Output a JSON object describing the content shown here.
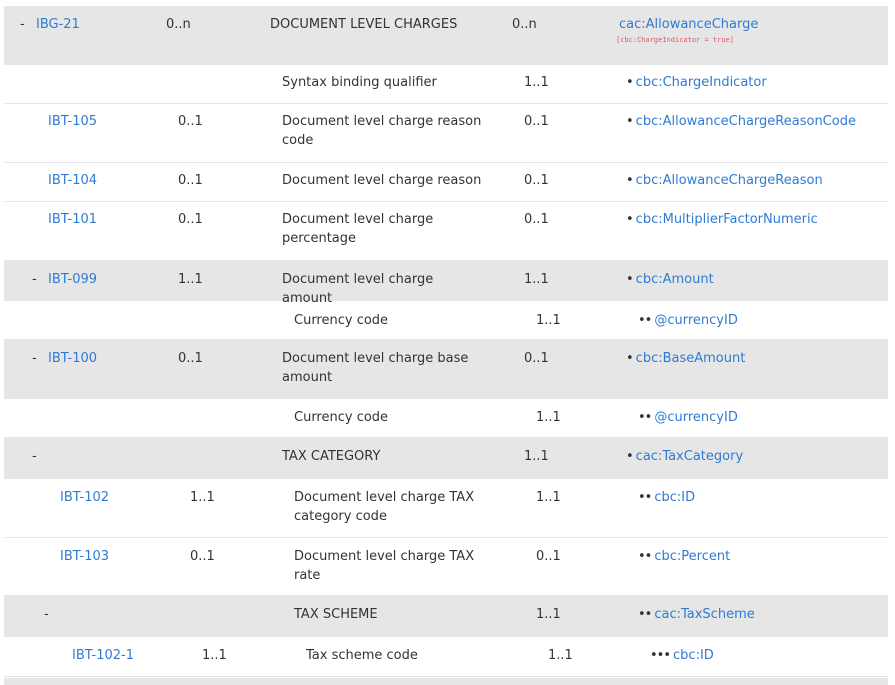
{
  "rows": [
    {
      "toggle": "-",
      "id": "IBG-21",
      "card": "0..n",
      "name": "DOCUMENT LEVEL CHARGES",
      "card2": "0..n",
      "bullets": "",
      "xpath": "cac:AllowanceCharge",
      "constraint": "[cbc:ChargeIndicator = true]",
      "group": true,
      "level": 0
    },
    {
      "toggle": "",
      "id": "",
      "card": "",
      "name": "Syntax binding qualifier",
      "card2": "1..1",
      "bullets": "•",
      "xpath": "cbc:ChargeIndicator",
      "constraint": "",
      "group": false,
      "level": 1
    },
    {
      "toggle": "",
      "id": "IBT-105",
      "card": "0..1",
      "name": "Document level charge reason code",
      "card2": "0..1",
      "bullets": "•",
      "xpath": "cbc:AllowanceChargeReasonCode",
      "constraint": "",
      "group": false,
      "level": 1
    },
    {
      "toggle": "",
      "id": "IBT-104",
      "card": "0..1",
      "name": "Document level charge reason",
      "card2": "0..1",
      "bullets": "•",
      "xpath": "cbc:AllowanceChargeReason",
      "constraint": "",
      "group": false,
      "level": 1
    },
    {
      "toggle": "",
      "id": "IBT-101",
      "card": "0..1",
      "name": "Document level charge percentage",
      "card2": "0..1",
      "bullets": "•",
      "xpath": "cbc:MultiplierFactorNumeric",
      "constraint": "",
      "group": false,
      "level": 1
    },
    {
      "toggle": "-",
      "id": "IBT-099",
      "card": "1..1",
      "name": "Document level charge amount",
      "card2": "1..1",
      "bullets": "•",
      "xpath": "cbc:Amount",
      "constraint": "",
      "group": true,
      "level": 1
    },
    {
      "toggle": "",
      "id": "",
      "card": "",
      "name": "Currency code",
      "card2": "1..1",
      "bullets": "••",
      "xpath": "@currencyID",
      "constraint": "",
      "group": false,
      "level": 2
    },
    {
      "toggle": "-",
      "id": "IBT-100",
      "card": "0..1",
      "name": "Document level charge base amount",
      "card2": "0..1",
      "bullets": "•",
      "xpath": "cbc:BaseAmount",
      "constraint": "",
      "group": true,
      "level": 1
    },
    {
      "toggle": "",
      "id": "",
      "card": "",
      "name": "Currency code",
      "card2": "1..1",
      "bullets": "••",
      "xpath": "@currencyID",
      "constraint": "",
      "group": false,
      "level": 2
    },
    {
      "toggle": "-",
      "id": "",
      "card": "",
      "name": "TAX CATEGORY",
      "card2": "1..1",
      "bullets": "•",
      "xpath": "cac:TaxCategory",
      "constraint": "",
      "group": true,
      "level": 1
    },
    {
      "toggle": "",
      "id": "IBT-102",
      "card": "1..1",
      "name": "Document level charge TAX category code",
      "card2": "1..1",
      "bullets": "••",
      "xpath": "cbc:ID",
      "constraint": "",
      "group": false,
      "level": 2
    },
    {
      "toggle": "",
      "id": "IBT-103",
      "card": "0..1",
      "name": "Document level charge TAX rate",
      "card2": "0..1",
      "bullets": "••",
      "xpath": "cbc:Percent",
      "constraint": "",
      "group": false,
      "level": 2
    },
    {
      "toggle": "-",
      "id": "",
      "card": "",
      "name": "TAX SCHEME",
      "card2": "1..1",
      "bullets": "••",
      "xpath": "cac:TaxScheme",
      "constraint": "",
      "group": true,
      "level": 2
    },
    {
      "toggle": "",
      "id": "IBT-102-1",
      "card": "1..1",
      "name": "Tax scheme code",
      "card2": "1..1",
      "bullets": "•••",
      "xpath": "cbc:ID",
      "constraint": "",
      "group": false,
      "level": 3
    }
  ]
}
